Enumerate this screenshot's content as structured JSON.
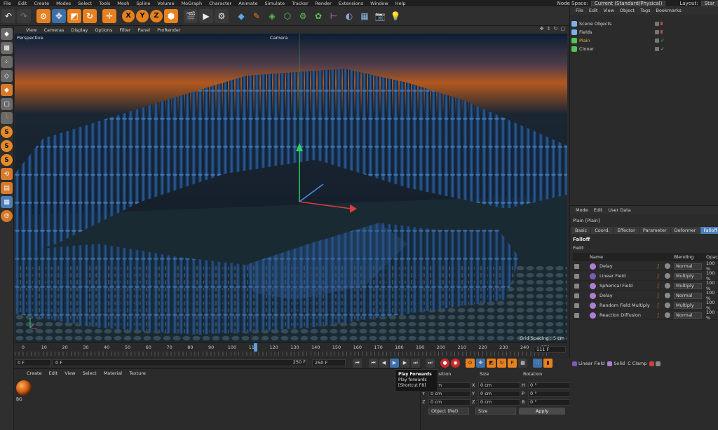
{
  "menubar": {
    "items": [
      "File",
      "Edit",
      "Create",
      "Modes",
      "Select",
      "Tools",
      "Mesh",
      "Spline",
      "Volume",
      "MoGraph",
      "Character",
      "Animate",
      "Simulate",
      "Tracker",
      "Render",
      "Extensions",
      "Window",
      "Help"
    ],
    "node_space_label": "Node Space:",
    "node_space_value": "Current (Standard/Physical)",
    "layout_label": "Layout:",
    "layout_value": "Star"
  },
  "toolbar": {
    "axis_x": "X",
    "axis_y": "Y",
    "axis_z": "Z"
  },
  "viewport": {
    "menu": [
      "View",
      "Cameras",
      "Display",
      "Options",
      "Filter",
      "Panel",
      "ProRender"
    ],
    "label_perspective": "Perspective",
    "label_camera": "Camera",
    "grid_spacing": "Grid Spacing : 5 cm"
  },
  "timeline": {
    "ruler": [
      "0",
      "10",
      "20",
      "30",
      "40",
      "50",
      "60",
      "70",
      "80",
      "90",
      "100",
      "110",
      "120",
      "130",
      "140",
      "150",
      "160",
      "170",
      "180",
      "190",
      "200",
      "210",
      "220",
      "230",
      "240",
      "250"
    ],
    "current_frame": "111 F",
    "playhead_fraction": 0.444
  },
  "transport": {
    "start_field": "0 F",
    "min_field": "0 F",
    "max_field": "250 F",
    "end_field": "250 F"
  },
  "tooltip": {
    "title": "Play Forwards",
    "line2": "Play forwards",
    "line3": "[Shortcut F8]"
  },
  "material_manager": {
    "menu": [
      "Create",
      "Edit",
      "View",
      "Select",
      "Material",
      "Texture"
    ],
    "material_name": "BG"
  },
  "coordinates": {
    "headers": {
      "position": "Position",
      "size": "Size",
      "rotation": "Rotation"
    },
    "rows": [
      {
        "axis": "X",
        "pos": "0 cm",
        "size_axis": "X",
        "size": "0 cm",
        "rot_axis": "H",
        "rot": "0 °"
      },
      {
        "axis": "Y",
        "pos": "0 cm",
        "size_axis": "Y",
        "size": "0 cm",
        "rot_axis": "P",
        "rot": "0 °"
      },
      {
        "axis": "Z",
        "pos": "0 cm",
        "size_axis": "Z",
        "size": "0 cm",
        "rot_axis": "B",
        "rot": "0 °"
      }
    ],
    "mode_dropdown": "Object (Rel)",
    "size_dropdown": "Size",
    "apply_label": "Apply"
  },
  "object_manager": {
    "menu": [
      "File",
      "Edit",
      "View",
      "Object",
      "Tags",
      "Bookmarks"
    ],
    "objects": [
      {
        "label": "Scene Objects",
        "color": "#7fb0e6"
      },
      {
        "label": "Fields",
        "color": "#7fb0e6"
      },
      {
        "label": "Plain",
        "color": "#f0b33a"
      },
      {
        "label": "Cloner",
        "color": "#57c25a"
      }
    ]
  },
  "attribute_manager": {
    "menu": [
      "Mode",
      "Edit",
      "User Data"
    ],
    "object_title": "Plain [Plain]",
    "tabs": [
      "Basic",
      "Coord.",
      "Effector",
      "Parameter",
      "Deformer",
      "Falloff"
    ],
    "active_tab": "Falloff",
    "section": "Falloff",
    "field_label": "Field",
    "columns": {
      "name": "Name",
      "blending": "Blending",
      "opacity": "Opacity"
    },
    "layers": [
      {
        "name": "Delay",
        "blend": "Normal",
        "opacity": "100 %"
      },
      {
        "name": "Linear Field",
        "blend": "Multiply",
        "opacity": "100 %"
      },
      {
        "name": "Spherical Field",
        "blend": "Multiply",
        "opacity": "100 %"
      },
      {
        "name": "Delay",
        "blend": "Normal",
        "opacity": "100 %"
      },
      {
        "name": "Random Field Multiply",
        "blend": "Multiply",
        "opacity": "100 %"
      },
      {
        "name": "Reaction Diffusion",
        "blend": "Normal",
        "opacity": "100 %"
      }
    ]
  },
  "fields_bar": {
    "linear": "Linear Field",
    "solid": "Solid",
    "clamp": "Clamp"
  },
  "colors": {
    "accent": "#e7801f",
    "active_tab": "#4f7fb8",
    "sky": "#b2581f"
  }
}
